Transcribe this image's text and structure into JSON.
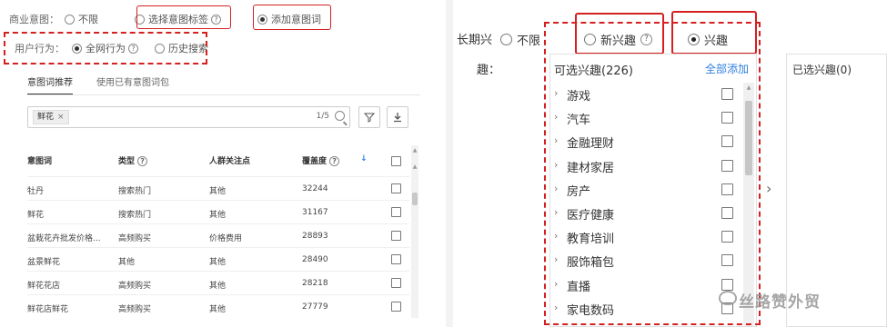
{
  "left": {
    "intent_label": "商业意图：",
    "intent_options": [
      {
        "label": "不限",
        "selected": false
      },
      {
        "label": "选择意图标签",
        "selected": false,
        "help": "?"
      },
      {
        "label": "添加意图词",
        "selected": true
      }
    ],
    "behavior_label": "用户行为：",
    "behavior_options": [
      {
        "label": "全网行为",
        "selected": true,
        "help": "?"
      },
      {
        "label": "历史搜索",
        "selected": false
      }
    ],
    "tabs": [
      "意图词推荐",
      "使用已有意图词包"
    ],
    "search": {
      "tag": "鲜花",
      "tag_close": "×",
      "count": "1/5"
    },
    "filter_icon": "filter-icon",
    "download_icon": "download-icon",
    "table": {
      "headers": [
        "意图词",
        "类型",
        "人群关注点",
        "覆盖度"
      ],
      "header_help": "?",
      "sort_arrow": "↓",
      "rows": [
        {
          "word": "牡丹",
          "type": "搜索热门",
          "focus": "其他",
          "coverage": "32244"
        },
        {
          "word": "鲜花",
          "type": "搜索热门",
          "focus": "其他",
          "coverage": "31167"
        },
        {
          "word": "盆栽花卉批发价格...",
          "type": "高频购买",
          "focus": "价格费用",
          "coverage": "28893"
        },
        {
          "word": "盆景鲜花",
          "type": "其他",
          "focus": "其他",
          "coverage": "28490"
        },
        {
          "word": "鲜花花店",
          "type": "高频购买",
          "focus": "其他",
          "coverage": "28218"
        },
        {
          "word": "鲜花店鲜花",
          "type": "高频购买",
          "focus": "其他",
          "coverage": "27779"
        }
      ]
    }
  },
  "right": {
    "long_term_label": "长期兴",
    "options": [
      {
        "label": "不限",
        "selected": false
      },
      {
        "label": "新兴趣",
        "selected": false,
        "help": "?"
      },
      {
        "label": "兴趣",
        "selected": true
      }
    ],
    "interest_label": "趣：",
    "panel_title": "可选兴趣(226)",
    "select_all": "全部添加",
    "interests": [
      "游戏",
      "汽车",
      "金融理财",
      "建材家居",
      "房产",
      "医疗健康",
      "教育培训",
      "服饰箱包",
      "直播",
      "家电数码"
    ],
    "arrow": "›",
    "selected_title": "已选兴趣(0)"
  },
  "watermark": "丝路赞外贸",
  "colors": {
    "highlight": "#d42020",
    "link": "#2f7fe0"
  }
}
